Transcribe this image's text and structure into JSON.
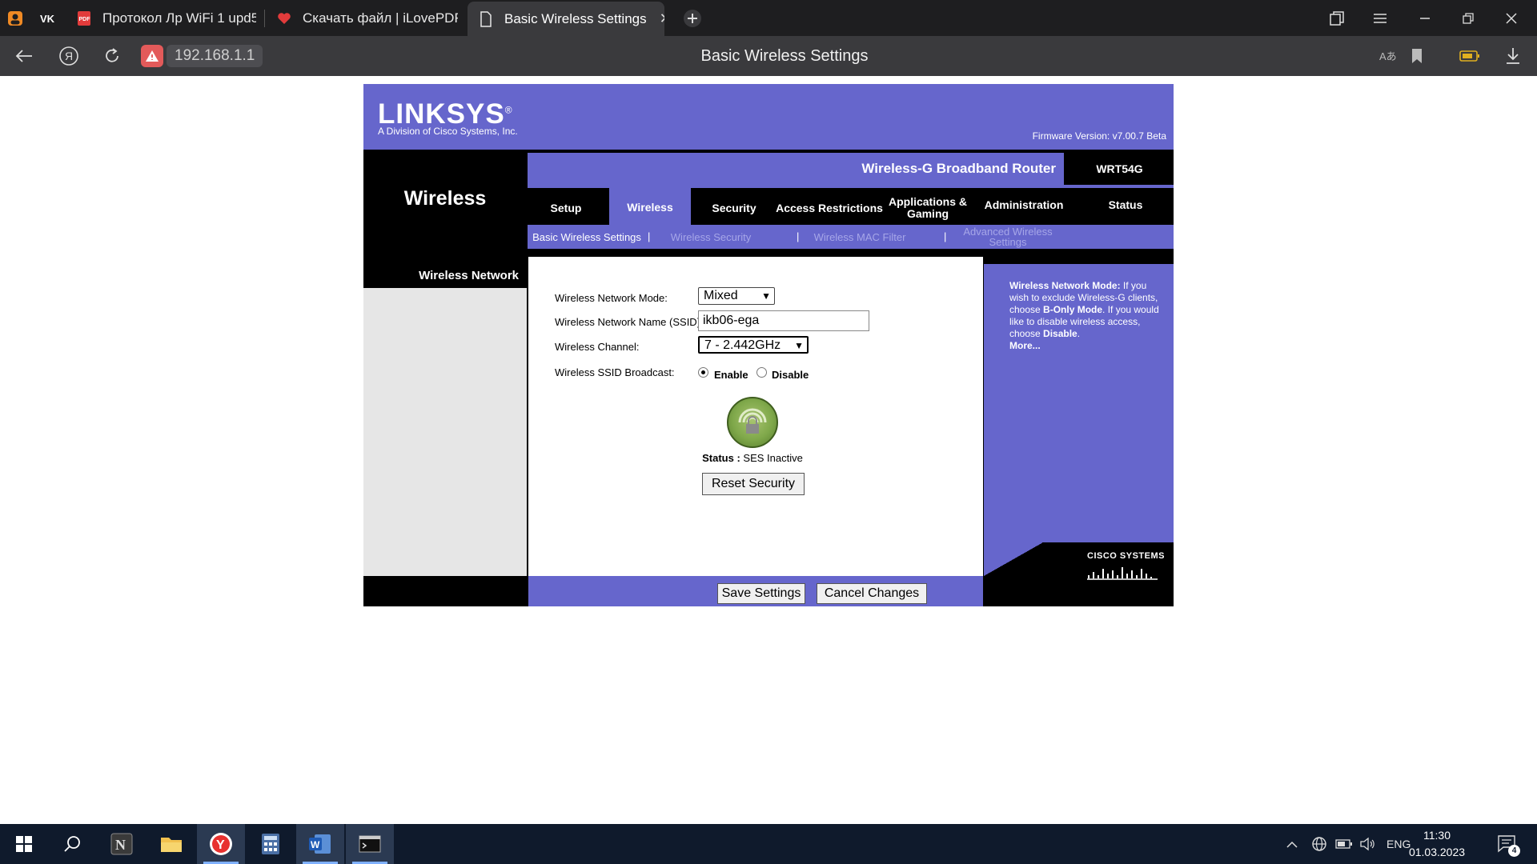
{
  "browser": {
    "tabs": [
      {
        "label": "",
        "icon": "profile-icon"
      },
      {
        "label": "",
        "icon": "vk-icon"
      },
      {
        "label": "Протокол Лр WiFi 1 upd5",
        "icon": "pdf-icon"
      },
      {
        "label": "Скачать файл | iLovePDF",
        "icon": "heart-icon"
      },
      {
        "label": "Basic Wireless Settings",
        "icon": "document-icon",
        "active": true
      }
    ],
    "url": "192.168.1.1",
    "page_title": "Basic Wireless Settings"
  },
  "router": {
    "brand": "LINKSYS",
    "brand_mark": "®",
    "brand_sub": "A Division of Cisco Systems, Inc.",
    "firmware": "Firmware Version: v7.00.7 Beta",
    "section_title": "Wireless",
    "product": "Wireless-G Broadband Router",
    "model": "WRT54G",
    "main_tabs": [
      {
        "label": "Setup"
      },
      {
        "label": "Wireless",
        "active": true
      },
      {
        "label": "Security"
      },
      {
        "label": "Access Restrictions"
      },
      {
        "label": "Applications & Gaming"
      },
      {
        "label": "Administration"
      },
      {
        "label": "Status"
      }
    ],
    "sub_tabs": [
      {
        "label": "Basic Wireless Settings",
        "active": true
      },
      {
        "label": "Wireless Security"
      },
      {
        "label": "Wireless MAC Filter"
      },
      {
        "label": "Advanced Wireless Settings"
      }
    ],
    "sub_sep": "|",
    "left_heading": "Wireless Network",
    "form": {
      "mode_label": "Wireless Network Mode:",
      "mode_value": "Mixed",
      "ssid_label": "Wireless Network Name (SSID):",
      "ssid_value": "ikb06-ega",
      "channel_label": "Wireless Channel:",
      "channel_value": "7 - 2.442GHz",
      "broadcast_label": "Wireless SSID Broadcast:",
      "enable_label": "Enable",
      "disable_label": "Disable",
      "broadcast_selected": "Enable"
    },
    "ses": {
      "status_label": "Status :",
      "status_value": "SES Inactive",
      "reset_button": "Reset Security"
    },
    "help": {
      "title": "Wireless Network Mode:",
      "text1": " If you wish to exclude Wireless-G clients, choose ",
      "bold1": "B-Only Mode",
      "text2": ". If you would like to disable wireless access, choose ",
      "bold2": "Disable",
      "text3": ".",
      "more": "More..."
    },
    "cisco": "CISCO SYSTEMS",
    "save_button": "Save Settings",
    "cancel_button": "Cancel Changes"
  },
  "taskbar": {
    "language": "ENG",
    "time": "11:30",
    "date": "01.03.2023",
    "notifications": "4"
  },
  "colors": {
    "router_purple": "#6666cc",
    "browser_dark": "#1e1e20",
    "taskbar": "#0f1a2c"
  }
}
